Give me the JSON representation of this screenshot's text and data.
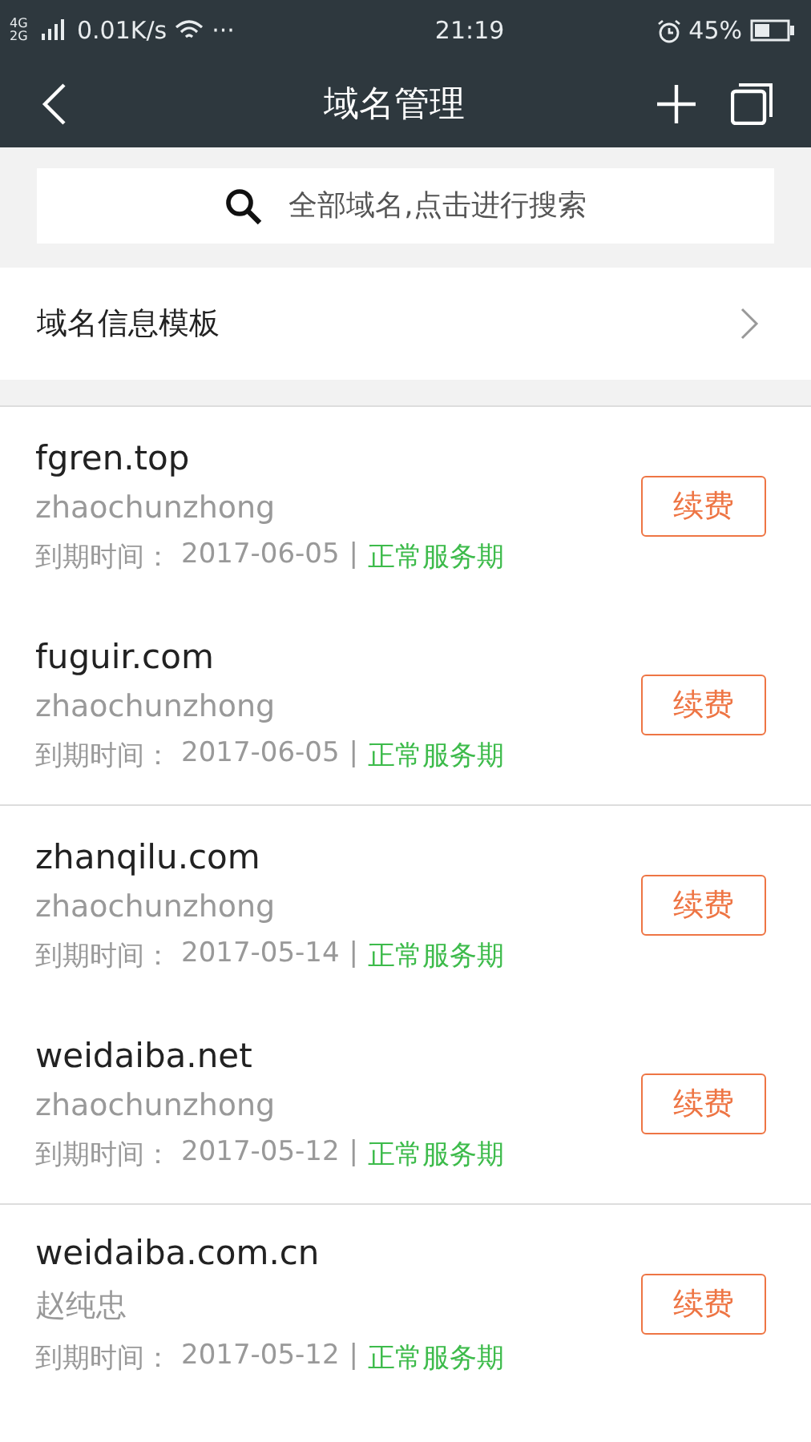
{
  "status_bar": {
    "network": "4G 2G",
    "speed": "0.01K/s",
    "more": "···",
    "time": "21:19",
    "battery": "45%"
  },
  "header": {
    "title": "域名管理"
  },
  "search": {
    "placeholder": "全部域名,点击进行搜索"
  },
  "template_row": {
    "label": "域名信息模板"
  },
  "groups": [
    {
      "domains": [
        {
          "name": "fgren.top",
          "owner": "zhaochunzhong",
          "expiry_label": "到期时间：",
          "date": "2017-06-05",
          "separator": "|",
          "status": "正常服务期",
          "action": "续费"
        },
        {
          "name": "fuguir.com",
          "owner": "zhaochunzhong",
          "expiry_label": "到期时间：",
          "date": "2017-06-05",
          "separator": "|",
          "status": "正常服务期",
          "action": "续费"
        }
      ]
    },
    {
      "domains": [
        {
          "name": "zhanqilu.com",
          "owner": "zhaochunzhong",
          "expiry_label": "到期时间：",
          "date": "2017-05-14",
          "separator": "|",
          "status": "正常服务期",
          "action": "续费"
        },
        {
          "name": "weidaiba.net",
          "owner": "zhaochunzhong",
          "expiry_label": "到期时间：",
          "date": "2017-05-12",
          "separator": "|",
          "status": "正常服务期",
          "action": "续费"
        }
      ]
    },
    {
      "domains": [
        {
          "name": "weidaiba.com.cn",
          "owner": "赵纯忠",
          "expiry_label": "到期时间：",
          "date": "2017-05-12",
          "separator": "|",
          "status": "正常服务期",
          "action": "续费"
        }
      ]
    }
  ]
}
